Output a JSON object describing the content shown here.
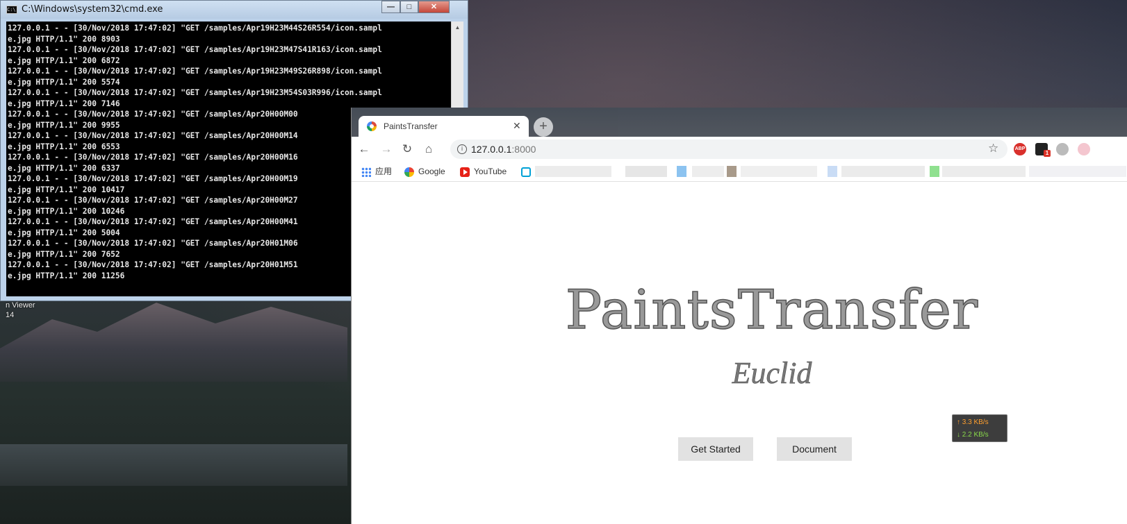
{
  "desktop": {
    "label_line1": "n Viewer",
    "label_line2": "14"
  },
  "cmd": {
    "title": "C:\\Windows\\system32\\cmd.exe",
    "icon_text": "C:\\",
    "minimize": "—",
    "maximize": "□",
    "close": "✕",
    "lines": [
      "127.0.0.1 - - [30/Nov/2018 17:47:02] \"GET /samples/Apr19H23M44S26R554/icon.sampl",
      "e.jpg HTTP/1.1\" 200 8903",
      "127.0.0.1 - - [30/Nov/2018 17:47:02] \"GET /samples/Apr19H23M47S41R163/icon.sampl",
      "e.jpg HTTP/1.1\" 200 6872",
      "127.0.0.1 - - [30/Nov/2018 17:47:02] \"GET /samples/Apr19H23M49S26R898/icon.sampl",
      "e.jpg HTTP/1.1\" 200 5574",
      "127.0.0.1 - - [30/Nov/2018 17:47:02] \"GET /samples/Apr19H23M54S03R996/icon.sampl",
      "e.jpg HTTP/1.1\" 200 7146",
      "127.0.0.1 - - [30/Nov/2018 17:47:02] \"GET /samples/Apr20H00M00",
      "e.jpg HTTP/1.1\" 200 9955",
      "127.0.0.1 - - [30/Nov/2018 17:47:02] \"GET /samples/Apr20H00M14",
      "e.jpg HTTP/1.1\" 200 6553",
      "127.0.0.1 - - [30/Nov/2018 17:47:02] \"GET /samples/Apr20H00M16",
      "e.jpg HTTP/1.1\" 200 6337",
      "127.0.0.1 - - [30/Nov/2018 17:47:02] \"GET /samples/Apr20H00M19",
      "e.jpg HTTP/1.1\" 200 10417",
      "127.0.0.1 - - [30/Nov/2018 17:47:02] \"GET /samples/Apr20H00M27",
      "e.jpg HTTP/1.1\" 200 10246",
      "127.0.0.1 - - [30/Nov/2018 17:47:02] \"GET /samples/Apr20H00M41",
      "e.jpg HTTP/1.1\" 200 5004",
      "127.0.0.1 - - [30/Nov/2018 17:47:02] \"GET /samples/Apr20H01M06",
      "e.jpg HTTP/1.1\" 200 7652",
      "127.0.0.1 - - [30/Nov/2018 17:47:02] \"GET /samples/Apr20H01M51",
      "e.jpg HTTP/1.1\" 200 11256"
    ],
    "scroll_up": "▲",
    "scroll_down": "▼"
  },
  "browser": {
    "tab_title": "PaintsTransfer",
    "tab_close": "✕",
    "new_tab": "+",
    "back": "←",
    "forward": "→",
    "reload": "↻",
    "home": "⌂",
    "info_glyph": "i",
    "url_host": "127.0.0.1",
    "url_port": ":8000",
    "bookmark_star": "☆",
    "extensions": {
      "abp": "ABP",
      "badge": "1"
    },
    "bookmarks": [
      {
        "label": "应用",
        "icon": "apps-icon"
      },
      {
        "label": "Google",
        "icon": "google-icon"
      },
      {
        "label": "YouTube",
        "icon": "youtube-icon"
      }
    ],
    "colors": {
      "tabstrip": "#3e4550",
      "omnibox": "#f1f3f4",
      "button_bg": "#e2e2e2"
    }
  },
  "page": {
    "title": "PaintsTransfer",
    "subtitle": "Euclid",
    "get_started": "Get Started",
    "document": "Document"
  },
  "netspeed": {
    "up": "↑ 3.3 KB/s",
    "down": "↓ 2.2 KB/s"
  }
}
